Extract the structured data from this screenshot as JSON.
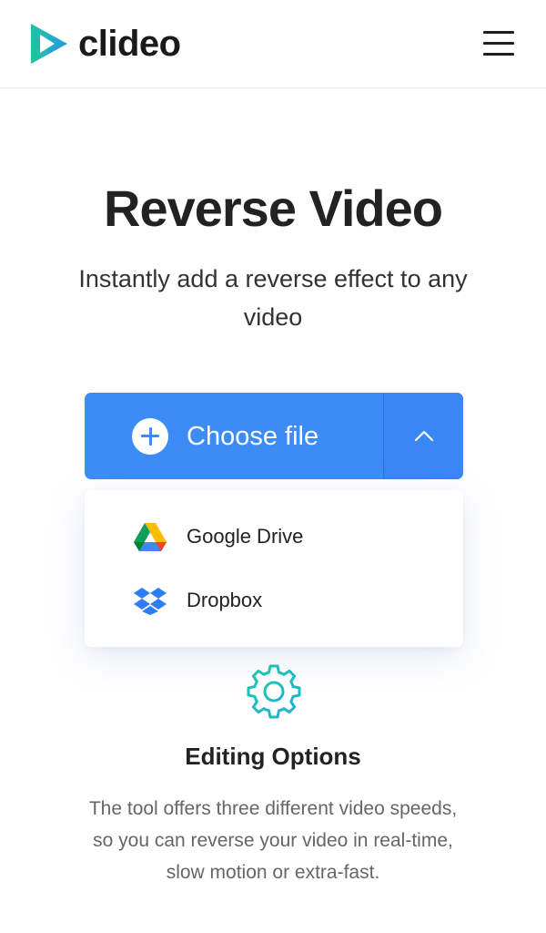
{
  "header": {
    "logo_text": "clideo",
    "menu_icon": "hamburger-menu-icon"
  },
  "hero": {
    "title": "Reverse Video",
    "subtitle": "Instantly add a reverse effect to any video"
  },
  "upload": {
    "choose_label": "Choose file",
    "plus_icon": "plus-circle-icon",
    "toggle_icon": "chevron-up-icon",
    "button_color": "#3d8cf6"
  },
  "dropdown": {
    "items": [
      {
        "label": "Google Drive",
        "icon": "google-drive-icon"
      },
      {
        "label": "Dropbox",
        "icon": "dropbox-icon"
      }
    ]
  },
  "editing": {
    "icon": "gear-icon",
    "title": "Editing Options",
    "description": "The tool offers three different video speeds, so you can reverse your video in real-time, slow motion or extra-fast."
  }
}
